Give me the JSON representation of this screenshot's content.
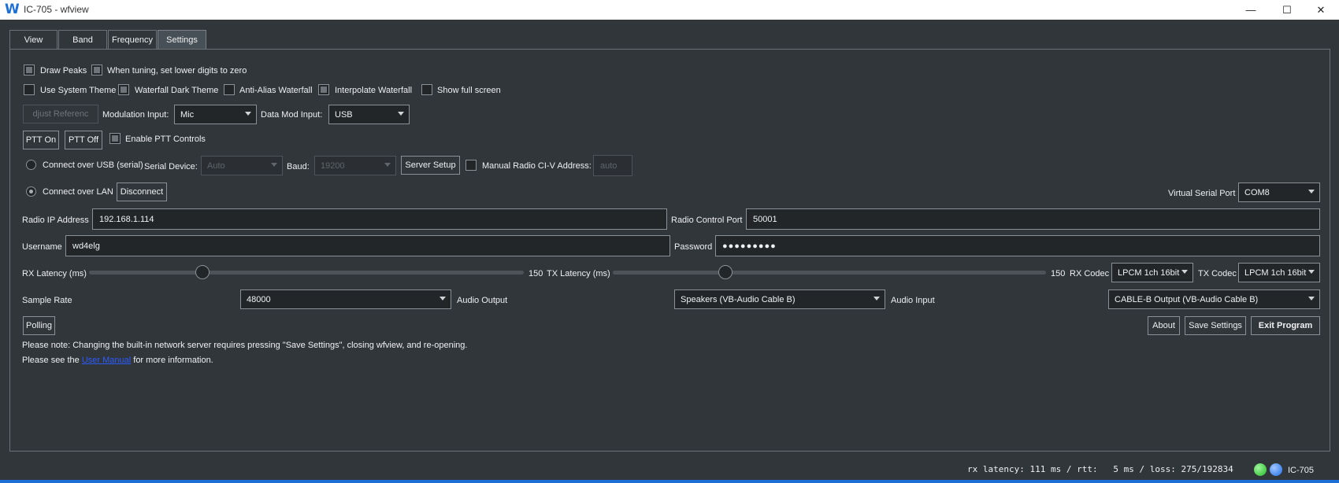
{
  "window": {
    "logo": "W",
    "title": "IC-705 - wfview",
    "minimize": "—",
    "maximize": "☐",
    "close": "✕"
  },
  "tabs": [
    {
      "label": "View",
      "active": false
    },
    {
      "label": "Band",
      "active": false
    },
    {
      "label": "Frequency",
      "active": false
    },
    {
      "label": "Settings",
      "active": true
    }
  ],
  "settings": {
    "draw_peaks": {
      "label": "Draw Peaks",
      "checked": true
    },
    "lower_digits": {
      "label": "When tuning, set lower digits to zero",
      "checked": true
    },
    "system_theme": {
      "label": "Use System Theme",
      "checked": false
    },
    "waterfall_dark": {
      "label": "Waterfall Dark Theme",
      "checked": true
    },
    "anti_alias": {
      "label": "Anti-Alias Waterfall",
      "checked": false
    },
    "interpolate": {
      "label": "Interpolate Waterfall",
      "checked": true
    },
    "full_screen": {
      "label": "Show full screen",
      "checked": false
    },
    "adjust_reference": "djust Referenc",
    "modulation_input_label": "Modulation Input:",
    "modulation_input_value": "Mic",
    "data_mod_input_label": "Data Mod Input:",
    "data_mod_input_value": "USB",
    "ptt_on": "PTT On",
    "ptt_off": "PTT Off",
    "enable_ptt": {
      "label": "Enable PTT Controls",
      "checked": true
    },
    "connect_usb": {
      "label": "Connect over USB (serial)",
      "checked": false
    },
    "serial_device_label": "Serial Device:",
    "serial_device_value": "Auto",
    "baud_label": "Baud:",
    "baud_value": "19200",
    "server_setup": "Server Setup",
    "manual_civ": {
      "label": "Manual Radio CI-V Address:",
      "checked": false
    },
    "civ_address": "auto",
    "connect_lan": {
      "label": "Connect over LAN",
      "checked": true
    },
    "disconnect": "Disconnect",
    "virtual_serial_label": "Virtual Serial Port",
    "virtual_serial_value": "COM8",
    "radio_ip_label": "Radio IP Address",
    "radio_ip_value": "192.168.1.114",
    "radio_port_label": "Radio Control Port",
    "radio_port_value": "50001",
    "username_label": "Username",
    "username_value": "wd4elg",
    "password_label": "Password",
    "password_value": "●●●●●●●●●",
    "rx_latency_label": "RX Latency (ms)",
    "rx_latency_value": "150",
    "rx_latency_fraction": 0.26,
    "tx_latency_label": "TX Latency (ms)",
    "tx_latency_value": "150",
    "tx_latency_fraction": 0.26,
    "rx_codec_label": "RX Codec",
    "rx_codec_value": "LPCM 1ch 16bit",
    "tx_codec_label": "TX Codec",
    "tx_codec_value": "LPCM 1ch 16bit",
    "sample_rate_label": "Sample Rate",
    "sample_rate_value": "48000",
    "audio_output_label": "Audio Output",
    "audio_output_value": "Speakers (VB-Audio Cable B)",
    "audio_input_label": "Audio Input",
    "audio_input_value": "CABLE-B Output (VB-Audio Cable B)",
    "polling": "Polling",
    "about": "About",
    "save_settings": "Save Settings",
    "exit_program": "Exit Program",
    "note": "Please note: Changing  the built-in network server requires pressing \"Save Settings\", closing wfview, and re-opening.",
    "see_prefix": "Please see the ",
    "user_manual": "User Manual",
    "see_suffix": " for more information."
  },
  "status": {
    "text": "rx latency: 111 ms / rtt:   5 ms / loss: 275/192834",
    "radio": "IC-705",
    "led1_color": "#22bb22",
    "led2_color": "#1e6ee8"
  }
}
